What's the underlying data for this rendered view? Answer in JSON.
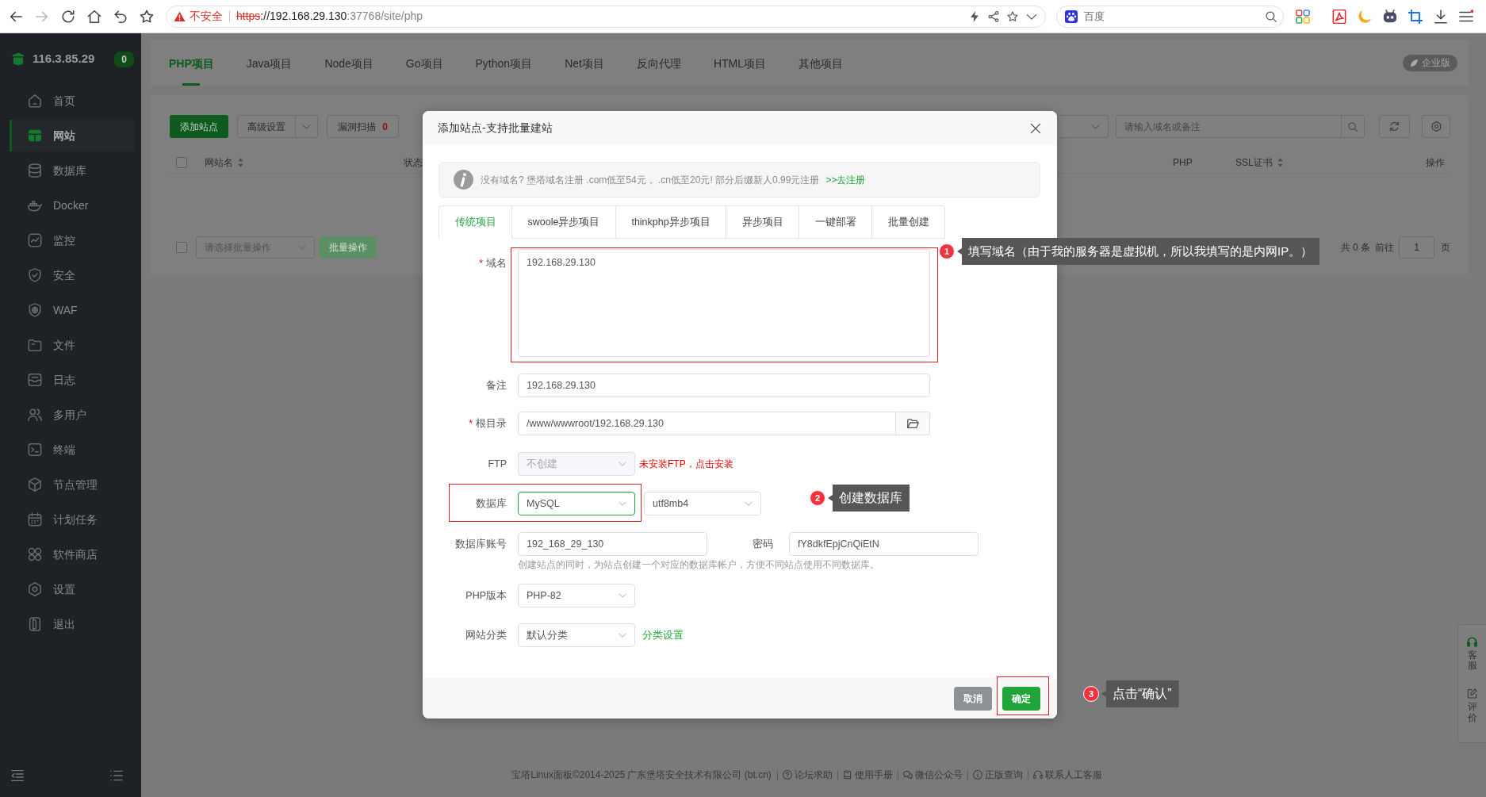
{
  "browser": {
    "security_label": "不安全",
    "url_scheme": "https",
    "url_host": "://192.168.29.130",
    "url_rest": ":37768/site/php",
    "search_placeholder": "百度"
  },
  "sidebar": {
    "server": "116.3.85.29",
    "badge": "0",
    "items": [
      {
        "label": "首页",
        "kind": "home",
        "selected": false
      },
      {
        "label": "网站",
        "kind": "sites",
        "selected": true
      },
      {
        "label": "数据库",
        "kind": "database",
        "selected": false
      },
      {
        "label": "Docker",
        "kind": "docker",
        "selected": false
      },
      {
        "label": "监控",
        "kind": "monitor",
        "selected": false
      },
      {
        "label": "安全",
        "kind": "security",
        "selected": false
      },
      {
        "label": "WAF",
        "kind": "waf",
        "selected": false
      },
      {
        "label": "文件",
        "kind": "files",
        "selected": false
      },
      {
        "label": "日志",
        "kind": "logs",
        "selected": false
      },
      {
        "label": "多用户",
        "kind": "users",
        "selected": false
      },
      {
        "label": "终端",
        "kind": "terminal",
        "selected": false
      },
      {
        "label": "节点管理",
        "kind": "nodes",
        "selected": false
      },
      {
        "label": "计划任务",
        "kind": "cron",
        "selected": false
      },
      {
        "label": "软件商店",
        "kind": "store",
        "selected": false
      },
      {
        "label": "设置",
        "kind": "settings",
        "selected": false
      },
      {
        "label": "退出",
        "kind": "logout",
        "selected": false
      }
    ]
  },
  "project_tabs": [
    {
      "label": "PHP项目",
      "selected": true
    },
    {
      "label": "Java项目",
      "selected": false
    },
    {
      "label": "Node项目",
      "selected": false
    },
    {
      "label": "Go项目",
      "selected": false
    },
    {
      "label": "Python项目",
      "selected": false
    },
    {
      "label": "Net项目",
      "selected": false
    },
    {
      "label": "反向代理",
      "selected": false
    },
    {
      "label": "HTML项目",
      "selected": false
    },
    {
      "label": "其他项目",
      "selected": false
    }
  ],
  "edition_badge": "企业版",
  "toolbar": {
    "add_button": "添加站点",
    "advanced_button": "高级设置",
    "scan_button": "漏洞扫描",
    "scan_count": "0",
    "search_placeholder": "请输入域名或备注"
  },
  "table": {
    "header_checked": false,
    "columns": [
      {
        "label": "网站名",
        "sortable": true
      },
      {
        "label": "状态",
        "sortable": false
      },
      {
        "label": "PHP",
        "sortable": false
      },
      {
        "label": "SSL证书",
        "sortable": true
      },
      {
        "label": "操作",
        "sortable": false
      }
    ]
  },
  "batch": {
    "checked": false,
    "placeholder": "请选择批量操作",
    "button": "批量操作",
    "button_disabled": true
  },
  "pagination": {
    "total": "共 0 条",
    "goto": "前往",
    "page": "1",
    "unit": "页"
  },
  "modal": {
    "title": "添加站点-支持批量建站",
    "notice": {
      "text": "没有域名? 堡塔域名注册 .com低至54元， .cn低至20元! 部分后缀新人0.99元注册",
      "link": ">>去注册"
    },
    "tabs": [
      {
        "label": "传统项目",
        "selected": true
      },
      {
        "label": "swoole异步项目",
        "selected": false
      },
      {
        "label": "thinkphp异步项目",
        "selected": false
      },
      {
        "label": "异步项目",
        "selected": false
      },
      {
        "label": "一键部署",
        "selected": false
      },
      {
        "label": "批量创建",
        "selected": false
      }
    ],
    "domain": {
      "label": "域名",
      "required_mark": "*",
      "value": "192.168.29.130",
      "highlighted": true
    },
    "remark": {
      "label": "备注",
      "value": "192.168.29.130"
    },
    "root_dir": {
      "label": "根目录",
      "required_mark": "*",
      "value": "/www/wwwroot/192.168.29.130"
    },
    "ftp": {
      "label": "FTP",
      "value": "不创建",
      "disabled": true,
      "focused": false,
      "warning": "未安装FTP，点击安装"
    },
    "database": {
      "label": "数据库",
      "value": "MySQL",
      "disabled": false,
      "focused": true,
      "charset": "utf8mb4",
      "highlighted": true
    },
    "db_account": {
      "label": "数据库账号",
      "value": "192_168_29_130",
      "password_label": "密码",
      "password": "fY8dkfEpjCnQiEtN",
      "hint": "创建站点的同时，为站点创建一个对应的数据库帐户，方便不同站点使用不同数据库。"
    },
    "php_version": {
      "label": "PHP版本",
      "value": "PHP-82",
      "disabled": false,
      "focused": false
    },
    "category": {
      "label": "网站分类",
      "value": "默认分类",
      "disabled": false,
      "focused": false,
      "link": "分类设置"
    },
    "cancel_button": "取消",
    "confirm_button": {
      "label": "确定",
      "highlighted": true
    }
  },
  "annotations": [
    {
      "number": "1",
      "text": "填写域名（由于我的服务器是虚拟机，所以我填写的是内网IP。）"
    },
    {
      "number": "2",
      "text": "创建数据库"
    },
    {
      "number": "3",
      "text": "点击“确认”"
    }
  ],
  "float_widgets": [
    {
      "label": "客服",
      "kind": "support"
    },
    {
      "label": "评价",
      "kind": "review"
    }
  ],
  "footer": {
    "copyright": "宝塔Linux面板©2014-2025 广东堡塔安全技术有限公司 (bt.cn)",
    "links": [
      {
        "label": "论坛求助",
        "kind": "help"
      },
      {
        "label": "使用手册",
        "kind": "manual"
      },
      {
        "label": "微信公众号",
        "kind": "wechat"
      },
      {
        "label": "正版查询",
        "kind": "verify"
      },
      {
        "label": "联系人工客服",
        "kind": "support"
      }
    ]
  }
}
